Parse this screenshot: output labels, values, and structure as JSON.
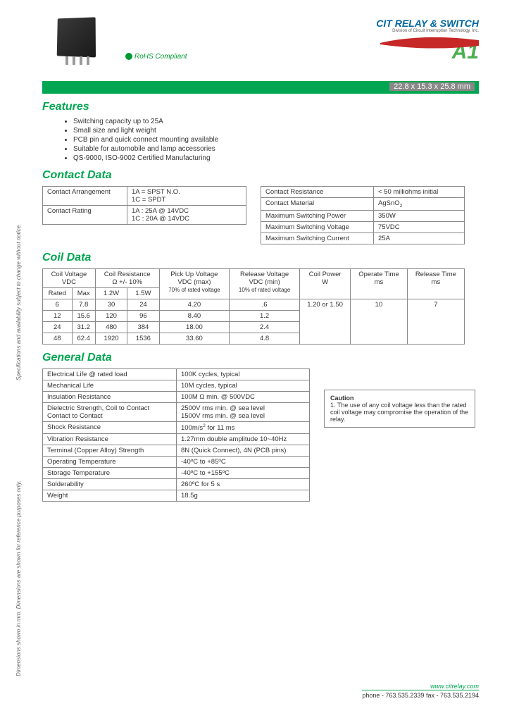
{
  "header": {
    "rohs": "RoHS Compliant",
    "logo": "CIT RELAY & SWITCH",
    "logo_sub": "Division of Circuit Interruption Technology, Inc.",
    "partno": "A1",
    "dims": "22.8 x 15.3 x 25.8 mm"
  },
  "features": {
    "title": "Features",
    "items": [
      "Switching capacity up to 25A",
      "Small size and light weight",
      "PCB pin and quick connect mounting available",
      "Suitable for automobile and lamp accessories",
      "QS-9000, ISO-9002 Certified Manufacturing"
    ]
  },
  "contact": {
    "title": "Contact Data",
    "left": [
      [
        "Contact Arrangement",
        "1A = SPST N.O.\n1C = SPDT"
      ],
      [
        "Contact Rating",
        "1A : 25A @ 14VDC\n1C : 20A @ 14VDC"
      ]
    ],
    "right": [
      [
        "Contact Resistance",
        "< 50 milliohms initial"
      ],
      [
        "Contact Material",
        "AgSnO₂"
      ],
      [
        "Maximum Switching Power",
        "350W"
      ],
      [
        "Maximum Switching Voltage",
        "75VDC"
      ],
      [
        "Maximum Switching Current",
        "25A"
      ]
    ]
  },
  "coil": {
    "title": "Coil Data",
    "headers": {
      "voltage": "Coil Voltage\nVDC",
      "resistance": "Coil Resistance\nΩ +/- 10%",
      "pickup": "Pick Up Voltage\nVDC (max)",
      "pickup_sub": "70% of rated voltage",
      "release": "Release Voltage\nVDC (min)",
      "release_sub": "10% of rated voltage",
      "power": "Coil Power\nW",
      "operate": "Operate Time\nms",
      "releaset": "Release Time\nms",
      "rated": "Rated",
      "max": "Max",
      "r12": "1.2W",
      "r15": "1.5W"
    },
    "rows": [
      [
        "6",
        "7.8",
        "30",
        "24",
        "4.20",
        ".6"
      ],
      [
        "12",
        "15.6",
        "120",
        "96",
        "8.40",
        "1.2"
      ],
      [
        "24",
        "31.2",
        "480",
        "384",
        "18.00",
        "2.4"
      ],
      [
        "48",
        "62.4",
        "1920",
        "1536",
        "33.60",
        "4.8"
      ]
    ],
    "power_val": "1.20 or 1.50",
    "operate_val": "10",
    "release_val": "7"
  },
  "general": {
    "title": "General Data",
    "rows": [
      [
        "Electrical Life @ rated load",
        "100K cycles, typical"
      ],
      [
        "Mechanical Life",
        "10M cycles, typical"
      ],
      [
        "Insulation Resistance",
        "100M Ω min. @ 500VDC"
      ],
      [
        "Dielectric Strength, Coil to Contact\n                        Contact to Contact",
        "2500V rms min. @ sea level\n1500V rms min. @ sea level"
      ],
      [
        "Shock Resistance",
        "100m/s² for 11 ms"
      ],
      [
        "Vibration Resistance",
        "1.27mm double amplitude 10~40Hz"
      ],
      [
        "Terminal (Copper Alloy) Strength",
        "8N (Quick Connect), 4N (PCB pins)"
      ],
      [
        "Operating Temperature",
        "-40ºC to +85ºC"
      ],
      [
        "Storage Temperature",
        "-40ºC to +155ºC"
      ],
      [
        "Solderability",
        "260ºC for 5 s"
      ],
      [
        "Weight",
        "18.5g"
      ]
    ]
  },
  "caution": {
    "title": "Caution",
    "text": "1. The use of any coil voltage less than the rated coil voltage may compromise the operation of the relay."
  },
  "side": {
    "s1": "Specifications and availability subject to change without notice.",
    "s2": "Dimensions shown in mm. Dimensions are shown for reference purposes only."
  },
  "footer": {
    "url": "www.citrelay.com",
    "phone": "phone - 763.535.2339    fax - 763.535.2194"
  }
}
